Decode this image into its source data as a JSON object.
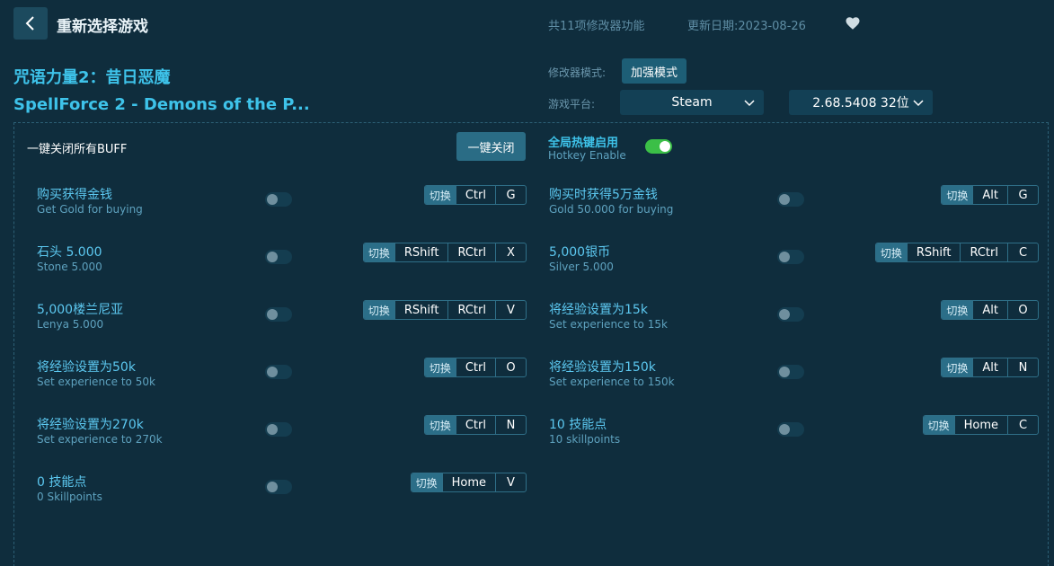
{
  "header": {
    "title": "重新选择游戏",
    "feature_count": "共11项修改器功能",
    "update_date": "更新日期:2023-08-26"
  },
  "game": {
    "title_cn": "咒语力量2：昔日恶魔",
    "title_en": "SpellForce 2 - Demons of the P..."
  },
  "settings": {
    "mode_label": "修改器模式:",
    "mode_value": "加强模式",
    "platform_label": "游戏平台:",
    "platform_value": "Steam",
    "version_value": "2.68.5408 32位"
  },
  "controls": {
    "buff_label": "一键关闭所有BUFF",
    "close_all_label": "一键关闭",
    "hotkey_title": "全局热键启用",
    "hotkey_sub": "Hotkey Enable",
    "hotkey_enabled": true
  },
  "switch_label": "切换",
  "cheats": [
    {
      "cn": "购买获得金钱",
      "en": "Get Gold for buying",
      "keys": [
        "Ctrl",
        "G"
      ],
      "enabled": false
    },
    {
      "cn": "购买时获得5万金钱",
      "en": "Gold 50.000 for buying",
      "keys": [
        "Alt",
        "G"
      ],
      "enabled": false
    },
    {
      "cn": "石头 5.000",
      "en": "Stone 5.000",
      "keys": [
        "RShift",
        "RCtrl",
        "X"
      ],
      "enabled": false
    },
    {
      "cn": "5,000银币",
      "en": "Silver 5.000",
      "keys": [
        "RShift",
        "RCtrl",
        "C"
      ],
      "enabled": false
    },
    {
      "cn": "5,000楼兰尼亚",
      "en": "Lenya 5.000",
      "keys": [
        "RShift",
        "RCtrl",
        "V"
      ],
      "enabled": false
    },
    {
      "cn": "将经验设置为15k",
      "en": "Set experience to 15k",
      "keys": [
        "Alt",
        "O"
      ],
      "enabled": false
    },
    {
      "cn": "将经验设置为50k",
      "en": "Set experience to 50k",
      "keys": [
        "Ctrl",
        "O"
      ],
      "enabled": false
    },
    {
      "cn": "将经验设置为150k",
      "en": "Set experience to 150k",
      "keys": [
        "Alt",
        "N"
      ],
      "enabled": false
    },
    {
      "cn": "将经验设置为270k",
      "en": "Set experience to 270k",
      "keys": [
        "Ctrl",
        "N"
      ],
      "enabled": false
    },
    {
      "cn": "10 技能点",
      "en": "10 skillpoints",
      "keys": [
        "Home",
        "C"
      ],
      "enabled": false
    },
    {
      "cn": "0 技能点",
      "en": "0 Skillpoints",
      "keys": [
        "Home",
        "V"
      ],
      "enabled": false
    }
  ]
}
